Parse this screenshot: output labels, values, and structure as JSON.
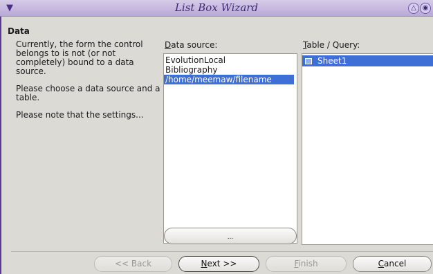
{
  "window": {
    "title": "List Box Wizard"
  },
  "section": {
    "title": "Data"
  },
  "info": {
    "paragraph1": "Currently, the form the control belongs to is not (or not completely) bound to a data source.",
    "paragraph2": "Please choose a data source and a table.",
    "paragraph3": "Please note that the settings..."
  },
  "data_source": {
    "label_mnemonic": "D",
    "label_rest": "ata source:",
    "items": [
      "EvolutionLocal",
      "Bibliography",
      "/home/meemaw/filename"
    ],
    "selected_index": 2,
    "browse_label": "..."
  },
  "table_query": {
    "label_mnemonic": "T",
    "label_rest": "able / Query:",
    "items": [
      "Sheet1"
    ],
    "selected_index": 0
  },
  "buttons": {
    "back": "<< Back",
    "next_mnemonic": "N",
    "next_rest": "ext >>",
    "finish_mnemonic": "F",
    "finish_rest": "inish",
    "cancel_mnemonic": "C",
    "cancel_rest": "ancel"
  }
}
